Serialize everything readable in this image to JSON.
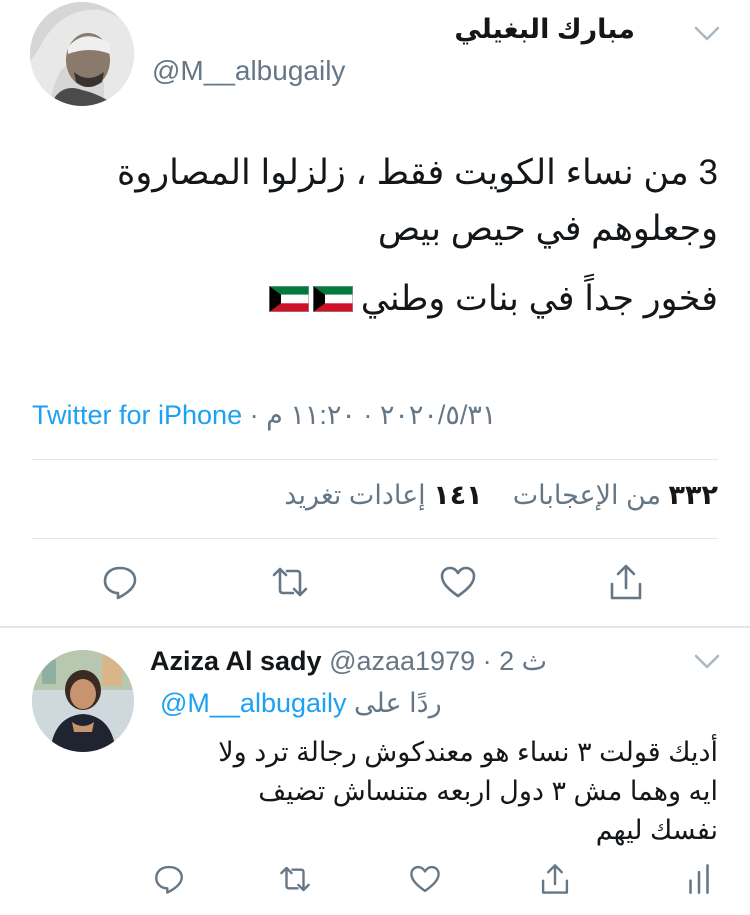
{
  "tweet": {
    "author_name": "مبارك البغيلي",
    "author_handle": "@M__albugaily",
    "lines": [
      "3 من نساء الكويت فقط ، زلزلوا المصاروة",
      "وجعلوهم في حيص بيص",
      "فخور جداً في بنات وطني"
    ],
    "flag_icon": "kuwait-flag-icon",
    "source": "Twitter for iPhone",
    "timestamp": " · ٢٠٢٠/٥/٣١ · ١١:٢٠ م",
    "likes_count": "٣٣٢",
    "likes_label": "من الإعجابات",
    "retweets_count": "١٤١",
    "retweets_label": "إعادات تغريد"
  },
  "actions": {
    "reply_icon": "comment-icon",
    "retweet_icon": "retweet-icon",
    "like_icon": "heart-icon",
    "share_icon": "share-icon",
    "analytics_icon": "analytics-icon"
  },
  "reply": {
    "name": "Aziza Al sady",
    "handle_and_time": "@azaa1979 · 2 ث",
    "replying_label": "ردًا على",
    "replying_to": "@M__albugaily",
    "lines": [
      "أديك قولت ٣ نساء هو معندكوش رجالة ترد ولا",
      "ايه وهما مش ٣ دول اربعه متنساش تضيف",
      "نفسك ليهم"
    ]
  },
  "colors": {
    "accent": "#1da1f2",
    "secondary_text": "#657786",
    "divider": "#e1e8ed"
  }
}
